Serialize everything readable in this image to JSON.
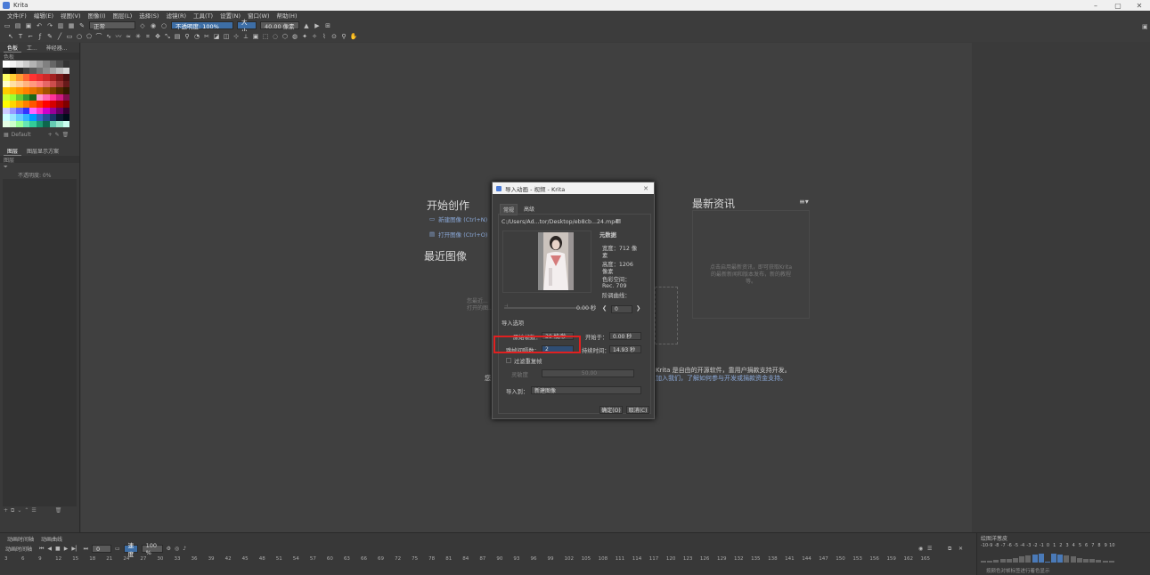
{
  "window": {
    "title": "Krita"
  },
  "menu": [
    "文件(F)",
    "编辑(E)",
    "视图(V)",
    "图像(I)",
    "图层(L)",
    "选择(S)",
    "滤镜(R)",
    "工具(T)",
    "设置(N)",
    "窗口(W)",
    "帮助(H)"
  ],
  "toolbar": {
    "blend_mode": "正常",
    "opacity": "不透明度: 100%",
    "size_label": "大小",
    "size_value": "40.00 像素"
  },
  "left_dock": {
    "top_tabs": [
      "色板",
      "工...",
      "神经器..."
    ],
    "palette_header": "色板",
    "palette_name": "Default",
    "layer_tabs": [
      "图层",
      "图层显示方案"
    ],
    "layers_header": "图层",
    "opacity": "不透明度: 0%",
    "swatch_colors": [
      "#ffffff",
      "#f2f2f2",
      "#e0e0e0",
      "#cccccc",
      "#b3b3b3",
      "#999999",
      "#808080",
      "#666666",
      "#4d4d4d",
      "#333333",
      "#1a1a1a",
      "#000000",
      "#262626",
      "#404040",
      "#595959",
      "#737373",
      "#8c8c8c",
      "#a6a6a6",
      "#bfbfbf",
      "#d9d9d9",
      "#ffff66",
      "#ffcc33",
      "#ff9933",
      "#ff6633",
      "#ff3333",
      "#e62e2e",
      "#cc2929",
      "#a32121",
      "#7a1919",
      "#4d1010",
      "#ffffcc",
      "#ffe0a3",
      "#ffcc99",
      "#ffb380",
      "#ff9980",
      "#ff8080",
      "#e66666",
      "#cc4d4d",
      "#993333",
      "#661a1a",
      "#ffcc00",
      "#ffb300",
      "#ff9900",
      "#ff8000",
      "#e67300",
      "#cc6600",
      "#a35200",
      "#7a3d00",
      "#522900",
      "#331a00",
      "#ccff33",
      "#99ff33",
      "#66cc33",
      "#339933",
      "#1a661a",
      "#ff99cc",
      "#ff66b3",
      "#ff3399",
      "#cc1a80",
      "#800d4d",
      "#ffff00",
      "#ffd500",
      "#ffaa00",
      "#ff7f00",
      "#ff5500",
      "#ff2a00",
      "#ff0000",
      "#d50000",
      "#aa0000",
      "#7f0000",
      "#ccccff",
      "#9999ff",
      "#6666ff",
      "#3333ff",
      "#ff66ff",
      "#ff33cc",
      "#cc00cc",
      "#990099",
      "#660066",
      "#330033",
      "#ccffff",
      "#99e6ff",
      "#66ccff",
      "#33b3ff",
      "#0099ff",
      "#3366cc",
      "#264d99",
      "#1a3366",
      "#0d1a33",
      "#000d1a",
      "#e6ffe6",
      "#ccffcc",
      "#99ff99",
      "#66e6b3",
      "#33cc99",
      "#1a9973",
      "#0d664d",
      "#66ccb3",
      "#99e6cc",
      "#ccfff2"
    ]
  },
  "welcome": {
    "start_title": "开始创作",
    "new_image": "新建图像 (Ctrl+N)",
    "open_image": "打开图像 (Ctrl+O)",
    "recent_title": "最近图像",
    "recent_hint_1": "您最近...",
    "recent_hint_2": "打开的图...",
    "news_title": "最新资讯",
    "news_text": "点击启用最新资讯，即可获取Krita 的最新新闻和版本发布，新的教程等。",
    "bottom_text_1": "Krita 是自由的开源软件，靠用户捐款支持开发。",
    "bottom_text_2": "加入我们，了解如何参与开发或捐款资金支持。",
    "bottom_text_prefix": "您"
  },
  "dialog": {
    "title": "导入动画 - 视频 - Krita",
    "tabs": [
      "常规",
      "高级"
    ],
    "file_path": "C:/Users/Ad...tor/Desktop/eb8cb...24.mp4",
    "metadata_title": "元数据",
    "width_line1": "宽度：712 像",
    "width_line2": "素",
    "height_line1": "高度：1206",
    "height_line2": "像素",
    "colorspace_label": "色彩空间：",
    "colorspace_value": "Rec. 709",
    "curve_label": "阶调曲线：",
    "frame_time": "0.00 秒",
    "frame_index": "0",
    "import_options_title": "导入选项",
    "fps_label": "原始帧数：",
    "fps_value": "30 帧/秒",
    "start_label": "开始于：",
    "start_value": "0.00 秒",
    "skip_label": "跳帧间隔数：",
    "skip_value": "2",
    "duration_label": "持续时间：",
    "duration_value": "14.93 秒",
    "filter_label": "过滤重复帧",
    "sensitivity_label": "灵敏度",
    "sensitivity_value": "50.00",
    "import_to_label": "导入到：",
    "import_to_value": "新建图像",
    "ok_button": "确定(O)",
    "cancel_button": "取消(C)"
  },
  "timeline": {
    "dock_tabs": [
      "动画时间轴",
      "动画曲线"
    ],
    "title": "动画时间轴",
    "frame_field": "0",
    "speed_label": "速度",
    "zoom": "100 %",
    "ruler": [
      "3",
      "6",
      "9",
      "12",
      "15",
      "18",
      "21",
      "24",
      "27",
      "30",
      "33",
      "36",
      "39",
      "42",
      "45",
      "48",
      "51",
      "54",
      "57",
      "60",
      "63",
      "66",
      "69",
      "72",
      "75",
      "78",
      "81",
      "84",
      "87",
      "90",
      "93",
      "96",
      "99",
      "102",
      "105",
      "108",
      "111",
      "114",
      "117",
      "120",
      "123",
      "126",
      "129",
      "132",
      "135",
      "138",
      "141",
      "144",
      "147",
      "150",
      "153",
      "156",
      "159",
      "162",
      "165"
    ]
  },
  "onion_skin": {
    "title": "绘图洋葱皮",
    "numbers": [
      "-10",
      "-9",
      "-8",
      "-7",
      "-6",
      "-5",
      "-4",
      "-3",
      "-2",
      "-1",
      "0",
      "1",
      "2",
      "3",
      "4",
      "5",
      "6",
      "7",
      "8",
      "9",
      "10"
    ],
    "levels": [
      0.15,
      0.2,
      0.25,
      0.3,
      0.35,
      0.45,
      0.55,
      0.65,
      0.75,
      0.85,
      0,
      0.85,
      0.75,
      0.65,
      0.55,
      0.45,
      0.35,
      0.3,
      0.25,
      0.2,
      0.15
    ],
    "hint": "按颜色对帧标签进行着色显示"
  },
  "colors": {
    "accent": "#3d6ea6",
    "highlight": "#e02020"
  }
}
